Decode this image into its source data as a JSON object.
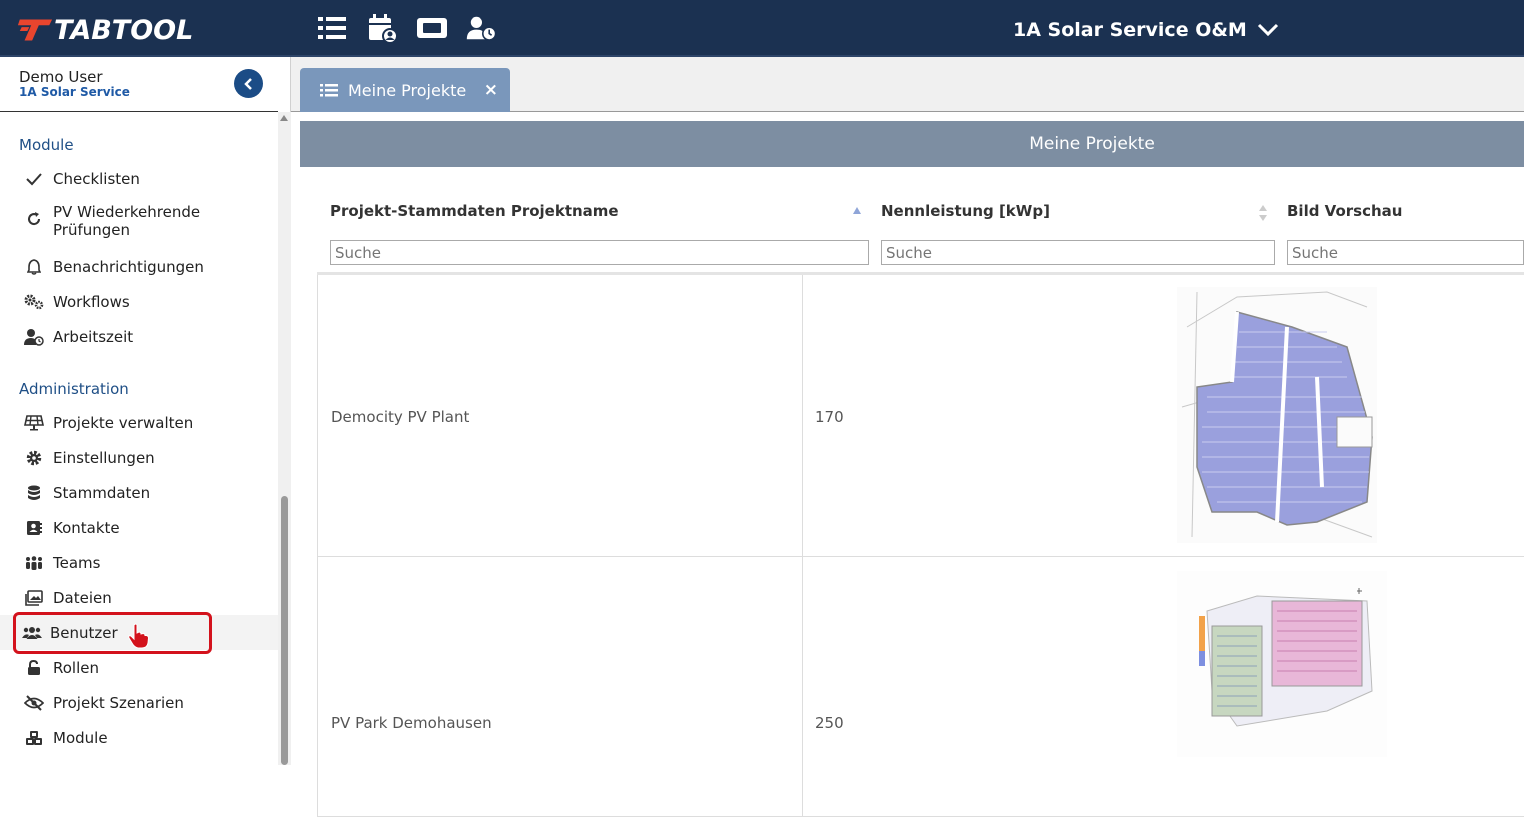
{
  "app": {
    "logo_text": "TABTOOL",
    "company_selector": "1A Solar Service O&M"
  },
  "topbar_icons": [
    "list-icon",
    "calendar-user-icon",
    "ticket-icon",
    "user-clock-icon"
  ],
  "user": {
    "name": "Demo User",
    "company": "1A Solar Service"
  },
  "sidebar": {
    "module_title": "Module",
    "module_items": [
      {
        "label": "Checklisten",
        "icon": "check-icon"
      },
      {
        "label": "PV Wiederkehrende\nPrüfungen",
        "icon": "refresh-icon"
      },
      {
        "label": "Benachrichtigungen",
        "icon": "bell-icon"
      },
      {
        "label": "Workflows",
        "icon": "cogs-icon"
      },
      {
        "label": "Arbeitszeit",
        "icon": "user-clock-icon"
      }
    ],
    "admin_title": "Administration",
    "admin_items": [
      {
        "label": "Projekte verwalten",
        "icon": "solar-panel-icon"
      },
      {
        "label": "Einstellungen",
        "icon": "gear-icon"
      },
      {
        "label": "Stammdaten",
        "icon": "database-icon"
      },
      {
        "label": "Kontakte",
        "icon": "address-book-icon"
      },
      {
        "label": "Teams",
        "icon": "people-group-icon"
      },
      {
        "label": "Dateien",
        "icon": "images-icon"
      },
      {
        "label": "Benutzer",
        "icon": "users-icon"
      },
      {
        "label": "Rollen",
        "icon": "unlock-icon"
      },
      {
        "label": "Projekt Szenarien",
        "icon": "eye-slash-icon"
      },
      {
        "label": "Module",
        "icon": "cubes-icon"
      }
    ]
  },
  "tab": {
    "label": "Meine Projekte",
    "close": "×"
  },
  "panel": {
    "title": "Meine Projekte"
  },
  "grid": {
    "columns": [
      {
        "header": "Projekt-Stammdaten Projektname",
        "search_placeholder": "Suche"
      },
      {
        "header": "Nennleistung [kWp]",
        "search_placeholder": "Suche"
      },
      {
        "header": "Bild Vorschau",
        "search_placeholder": "Suche"
      }
    ],
    "rows": [
      {
        "name": "Democity PV Plant",
        "power": "170"
      },
      {
        "name": "PV Park Demohausen",
        "power": "250"
      }
    ]
  },
  "colors": {
    "topbar": "#1b3151",
    "tab": "#7a97bb",
    "panel_header": "#7d8ea2",
    "accent": "#1f5aa6",
    "highlight": "#d3121c"
  }
}
